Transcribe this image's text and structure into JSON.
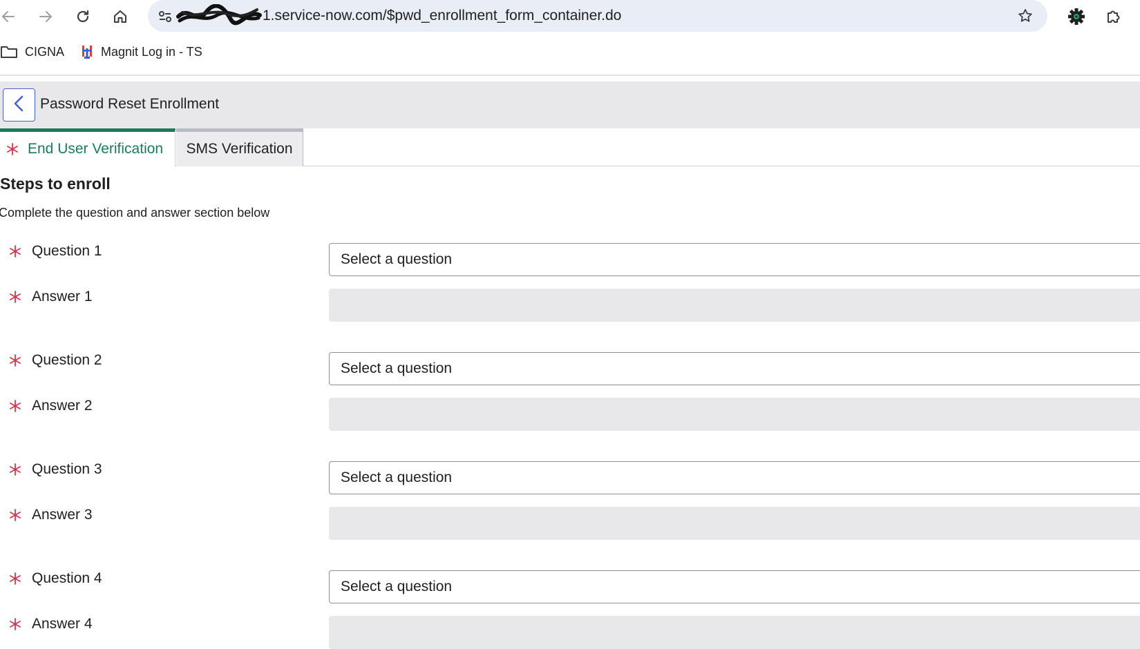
{
  "browser": {
    "url": "1.service-now.com/$pwd_enrollment_form_container.do",
    "bookmarks": [
      {
        "label": "CIGNA"
      },
      {
        "label": "Magnit Log in - TS"
      }
    ]
  },
  "header": {
    "title": "Password Reset Enrollment"
  },
  "tabs": [
    {
      "label": "End User Verification"
    },
    {
      "label": "SMS Verification"
    }
  ],
  "section": {
    "title": "Steps to enroll",
    "subtitle": "Complete the question and answer section below"
  },
  "form": {
    "rows": [
      {
        "question_label": "Question 1",
        "question_value": "Select a question",
        "answer_label": "Answer 1",
        "answer_value": ""
      },
      {
        "question_label": "Question 2",
        "question_value": "Select a question",
        "answer_label": "Answer 2",
        "answer_value": ""
      },
      {
        "question_label": "Question 3",
        "question_value": "Select a question",
        "answer_label": "Answer 3",
        "answer_value": ""
      },
      {
        "question_label": "Question 4",
        "question_value": "Select a question",
        "answer_label": "Answer 4",
        "answer_value": ""
      }
    ]
  },
  "colors": {
    "accent_green": "#1a7a5c",
    "required_red": "#d4344a",
    "back_button_blue": "#4c5fc7",
    "extension_green": "#1fa36a"
  },
  "icons": {
    "back": "arrow-left-icon",
    "forward": "arrow-right-icon",
    "reload": "reload-icon",
    "home": "home-icon",
    "site_info": "tune-icon",
    "bookmark_star": "star-icon",
    "extension": "gear-extension-icon",
    "extensions_menu": "puzzle-icon",
    "folder": "folder-icon",
    "magnit": "magnit-logo-icon",
    "required": "asterisk-icon",
    "page_back": "chevron-left-icon"
  }
}
